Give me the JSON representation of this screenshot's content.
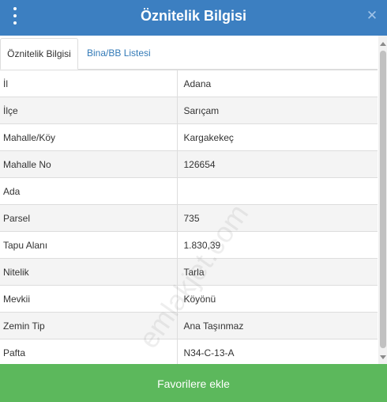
{
  "header": {
    "title": "Öznitelik Bilgisi",
    "close_symbol": "✕"
  },
  "tabs": [
    {
      "label": "Öznitelik Bilgisi",
      "active": true
    },
    {
      "label": "Bina/BB Listesi",
      "active": false
    }
  ],
  "attributes": [
    {
      "key": "İl",
      "value": "Adana"
    },
    {
      "key": "İlçe",
      "value": "Sarıçam"
    },
    {
      "key": "Mahalle/Köy",
      "value": "Kargakekeç"
    },
    {
      "key": "Mahalle No",
      "value": "126654"
    },
    {
      "key": "Ada",
      "value": ""
    },
    {
      "key": "Parsel",
      "value": "735"
    },
    {
      "key": "Tapu Alanı",
      "value": "1.830,39"
    },
    {
      "key": "Nitelik",
      "value": "Tarla"
    },
    {
      "key": "Mevkii",
      "value": "Köyönü"
    },
    {
      "key": "Zemin Tip",
      "value": "Ana Taşınmaz"
    },
    {
      "key": "Pafta",
      "value": "N34-C-13-A"
    }
  ],
  "watermark": "emlakjet.com",
  "footer": {
    "button_label": "Favorilere ekle"
  },
  "colors": {
    "header": "#3c7fc1",
    "footer_button": "#5cb85c",
    "tab_link": "#337ab7"
  },
  "icons": {
    "menu": "more-vertical-icon",
    "close": "close-icon"
  }
}
